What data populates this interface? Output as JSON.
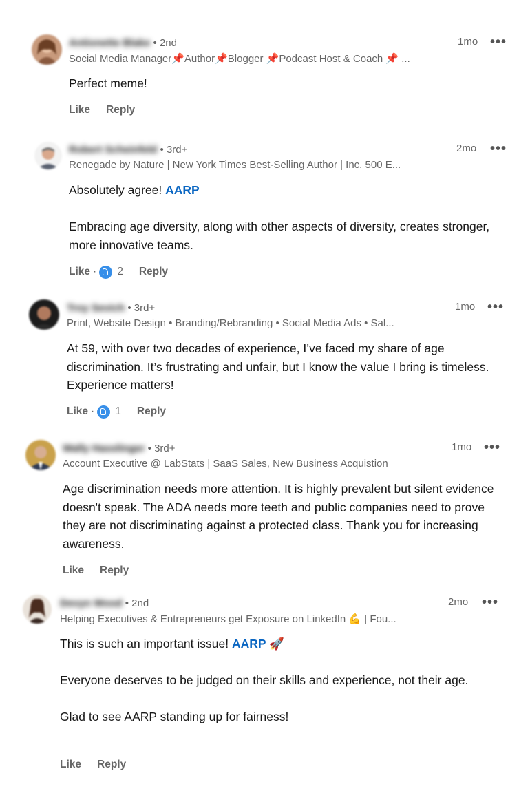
{
  "comments": [
    {
      "name": "Antionette Blake",
      "degree": "• 2nd",
      "headline": "Social Media Manager📌Author📌Blogger 📌Podcast Host & Coach 📌 ...",
      "time": "1mo",
      "more": "•••",
      "body": [
        "Perfect meme!"
      ],
      "like": "Like",
      "reply": "Reply"
    },
    {
      "name": "Robert Scheinfeld",
      "degree": "• 3rd+",
      "headline": "Renegade by Nature | New York Times Best-Selling Author | Inc. 500 E...",
      "time": "2mo",
      "more": "•••",
      "body_prefix": "Absolutely agree! ",
      "mention": "AARP",
      "body2": "Embracing age diversity, along with other aspects of diversity, creates stronger, more innovative teams.",
      "like": "Like",
      "dot": "·",
      "reactions": "2",
      "reply": "Reply"
    },
    {
      "name": "Troy Sevich",
      "degree": "• 3rd+",
      "headline": "Print, Website Design • Branding/Rebranding • Social Media Ads • Sal...",
      "time": "1mo",
      "more": "•••",
      "body": [
        "At 59, with over two decades of experience, I’ve faced my share of age discrimination. It’s frustrating and unfair, but I know the value I bring is timeless. Experience matters!"
      ],
      "like": "Like",
      "dot": "·",
      "reactions": "1",
      "reply": "Reply"
    },
    {
      "name": "Wally Hasslinger",
      "degree": "• 3rd+",
      "headline": "Account Executive @ LabStats | SaaS Sales, New Business Acquistion",
      "time": "1mo",
      "more": "•••",
      "body": [
        "Age discrimination needs more attention. It is highly prevalent but silent evidence doesn't speak. The ADA needs more teeth and public companies need to prove they are not discriminating against a protected class. Thank you for increasing awareness."
      ],
      "like": "Like",
      "reply": "Reply"
    },
    {
      "name": "Devyn Wood",
      "degree": "• 2nd",
      "headline": "Helping Executives & Entrepreneurs get Exposure on LinkedIn 💪 | Fou...",
      "time": "2mo",
      "more": "•••",
      "body_prefix": "This is such an important issue! ",
      "mention": "AARP",
      "body_suffix": " 🚀",
      "body2": "Everyone deserves to be judged on their skills and experience, not their age.",
      "body3": "Glad to see AARP standing up for fairness!",
      "like": "Like",
      "reply": "Reply"
    }
  ]
}
